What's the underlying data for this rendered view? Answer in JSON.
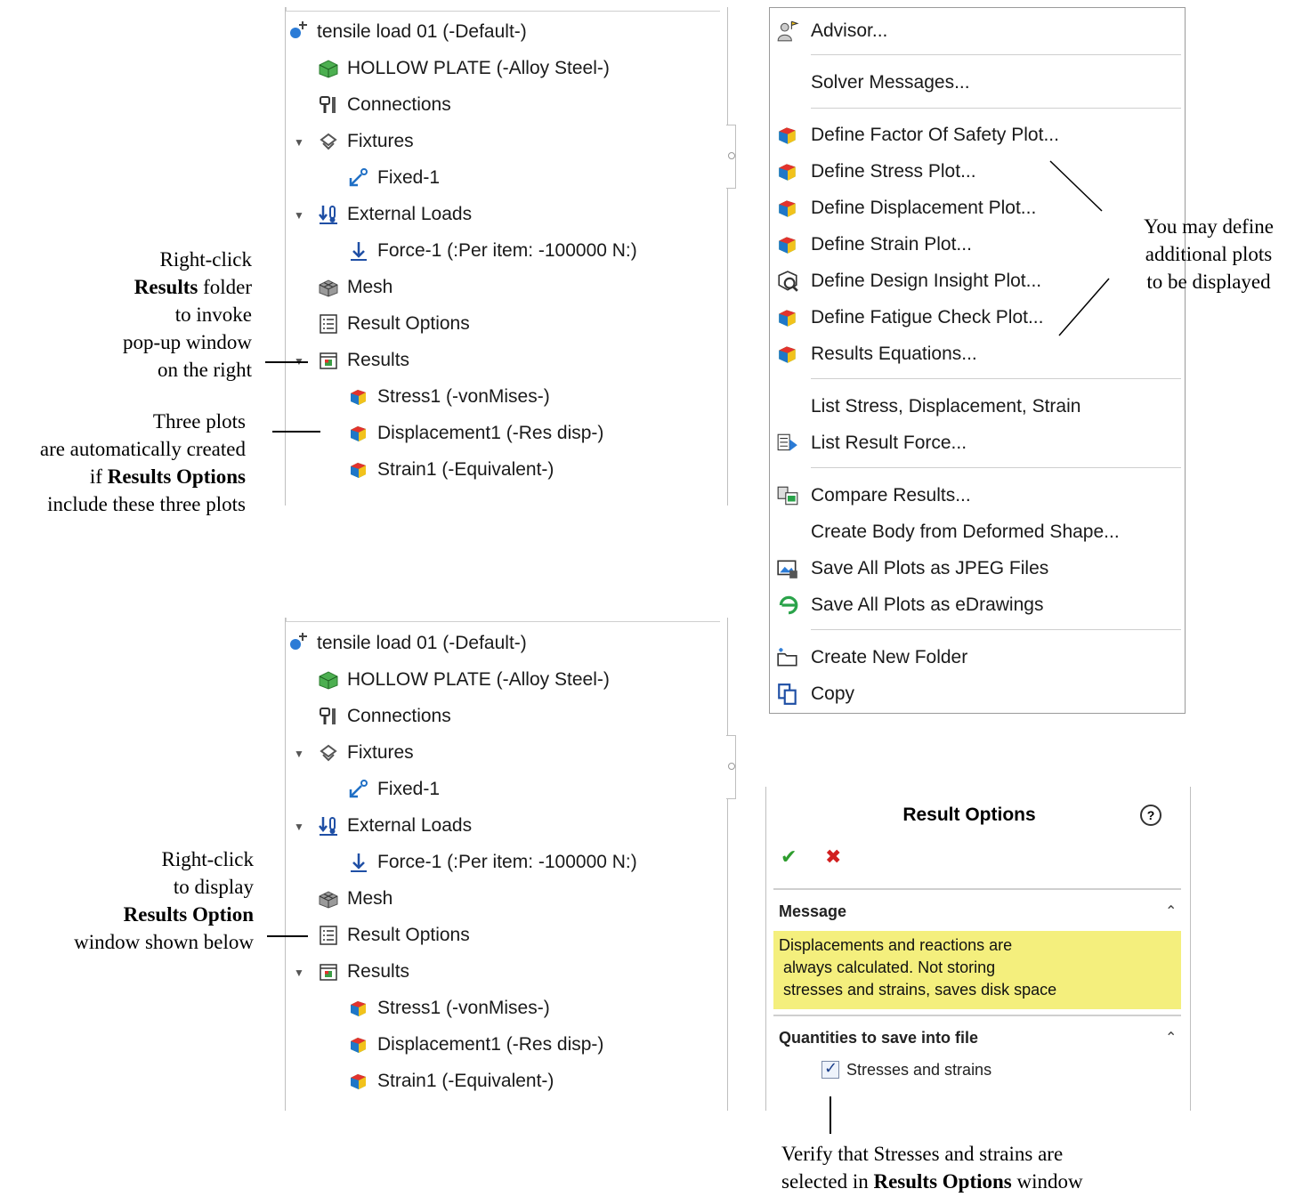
{
  "tree": {
    "study": "tensile load 01 (-Default-)",
    "part": "HOLLOW PLATE (-Alloy Steel-)",
    "connections": "Connections",
    "fixtures": "Fixtures",
    "fixed": "Fixed-1",
    "external_loads": "External Loads",
    "force": "Force-1 (:Per item: -100000 N:)",
    "mesh": "Mesh",
    "result_options": "Result Options",
    "results": "Results",
    "stress": "Stress1 (-vonMises-)",
    "displacement": "Displacement1 (-Res disp-)",
    "strain": "Strain1 (-Equivalent-)"
  },
  "menu": {
    "items": [
      {
        "label": "Advisor...",
        "icon": "advisor-icon"
      },
      {
        "label": "Solver Messages...",
        "icon": ""
      },
      {
        "label": "Define Factor Of Safety Plot...",
        "icon": "factor-of-safety-plot-icon"
      },
      {
        "label": "Define Stress Plot...",
        "icon": "stress-plot-icon"
      },
      {
        "label": "Define Displacement Plot...",
        "icon": "displacement-plot-icon"
      },
      {
        "label": "Define Strain Plot...",
        "icon": "strain-plot-icon"
      },
      {
        "label": "Define Design Insight Plot...",
        "icon": "design-insight-plot-icon"
      },
      {
        "label": "Define Fatigue Check Plot...",
        "icon": "fatigue-check-plot-icon"
      },
      {
        "label": "Results Equations...",
        "icon": "results-equations-icon"
      },
      {
        "label": "List Stress, Displacement, Strain",
        "icon": ""
      },
      {
        "label": "List Result Force...",
        "icon": "list-result-force-icon"
      },
      {
        "label": "Compare Results...",
        "icon": "compare-results-icon"
      },
      {
        "label": "Create Body from Deformed Shape...",
        "icon": ""
      },
      {
        "label": "Save All Plots as JPEG Files",
        "icon": "save-jpeg-icon"
      },
      {
        "label": "Save All Plots as eDrawings",
        "icon": "edrawings-icon"
      },
      {
        "label": "Create New Folder",
        "icon": "new-folder-icon"
      },
      {
        "label": "Copy",
        "icon": "copy-icon"
      }
    ]
  },
  "result_options_panel": {
    "title": "Result Options",
    "help": "?",
    "ok": "✔",
    "cancel": "✖",
    "message_header": "Message",
    "message_lines": [
      "Displacements and reactions are",
      " always calculated. Not storing",
      " stresses and strains, saves disk space"
    ],
    "quantities_header": "Quantities to save into file",
    "checkbox_label": "Stresses and strains",
    "checkbox_checked": true
  },
  "annotations": {
    "a1": [
      "Right-click",
      "Results",
      " folder",
      "to invoke",
      "pop-up window",
      "on the right"
    ],
    "a2": [
      "Three plots",
      "are automatically created",
      "if ",
      "Results Options",
      "include these three plots"
    ],
    "a3": [
      "You may define",
      "additional plots",
      "to be displayed"
    ],
    "a4": [
      "Right-click",
      "to display",
      "Results Option",
      "window shown below"
    ],
    "a5": [
      "Verify that Stresses and strains are",
      "selected in ",
      "Results Options",
      " window"
    ]
  }
}
